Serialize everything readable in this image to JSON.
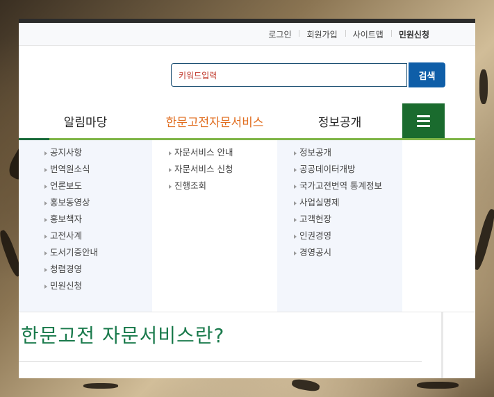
{
  "utility_links": [
    "로그인",
    "회원가입",
    "사이트맵",
    "민원신청"
  ],
  "search": {
    "placeholder": "키워드입력",
    "button_label": "검색"
  },
  "gnb": {
    "items": [
      "알림마당",
      "한문고전자문서비스",
      "정보공개"
    ],
    "active_color": "#e06d1f",
    "allmenu_icon": "hamburger-icon"
  },
  "submenu": {
    "col1": [
      "공지사항",
      "번역원소식",
      "언론보도",
      "홍보동영상",
      "홍보책자",
      "고전사계",
      "도서기증안내",
      "청렴경영",
      "민원신청"
    ],
    "col2": [
      "자문서비스 안내",
      "자문서비스 신청",
      "진행조회"
    ],
    "col3": [
      "정보공개",
      "공공데이터개방",
      "국가고전번역 통계정보",
      "사업실명제",
      "고객헌장",
      "인권경영",
      "경영공시"
    ]
  },
  "content": {
    "title": "한문고전 자문서비스란?"
  },
  "colors": {
    "brand_green": "#1a6b2e",
    "search_blue": "#0f5ea8",
    "accent_line": "#7fb547"
  }
}
